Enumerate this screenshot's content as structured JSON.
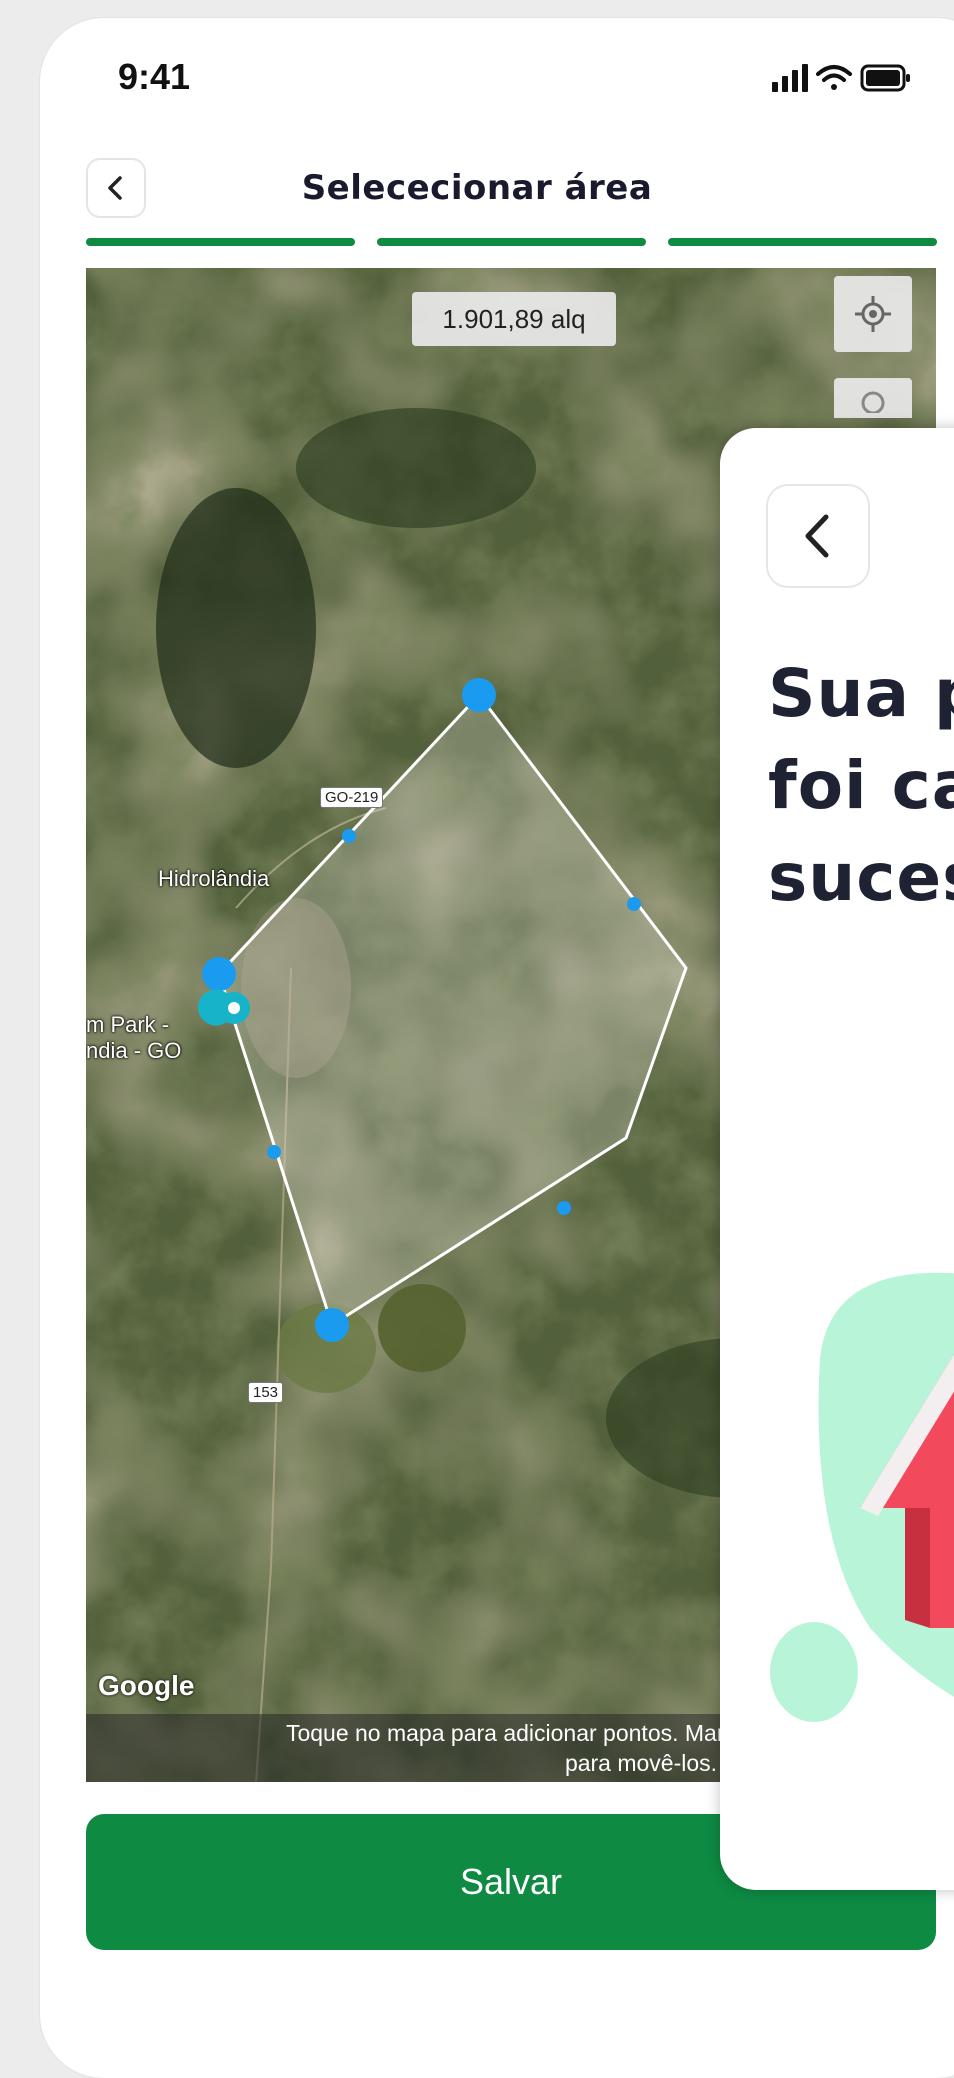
{
  "status_bar": {
    "time": "9:41"
  },
  "header": {
    "title": "Selececionar área"
  },
  "progress": {
    "total_steps": 3,
    "completed_steps": 3
  },
  "map": {
    "area_display": "1.901,89 alq",
    "road_labels": [
      "GO-219",
      "153"
    ],
    "place_labels": {
      "town": "Hidrolândia",
      "poi_line1": "m Park -",
      "poi_line2": "ndia - GO"
    },
    "google_logo": "Google",
    "hint_line1": "Toque no mapa para adicionar pontos. Mant",
    "hint_line2": "para movê-los."
  },
  "actions": {
    "save_label": "Salvar"
  },
  "overlay": {
    "title_line1": "Sua pr",
    "title_line2": "foi cad",
    "title_line3": "sucess"
  },
  "colors": {
    "primary_green": "#0e8a43",
    "polygon_vertex": "#1a9bf0",
    "mint_blob": "#b8f5d8",
    "house_red": "#f24a5c",
    "title_text": "#1f2233"
  },
  "icons": [
    "back-chevron-icon",
    "signal-icon",
    "wifi-icon",
    "battery-icon",
    "locate-icon",
    "zoom-icon",
    "map-pin-icon"
  ]
}
